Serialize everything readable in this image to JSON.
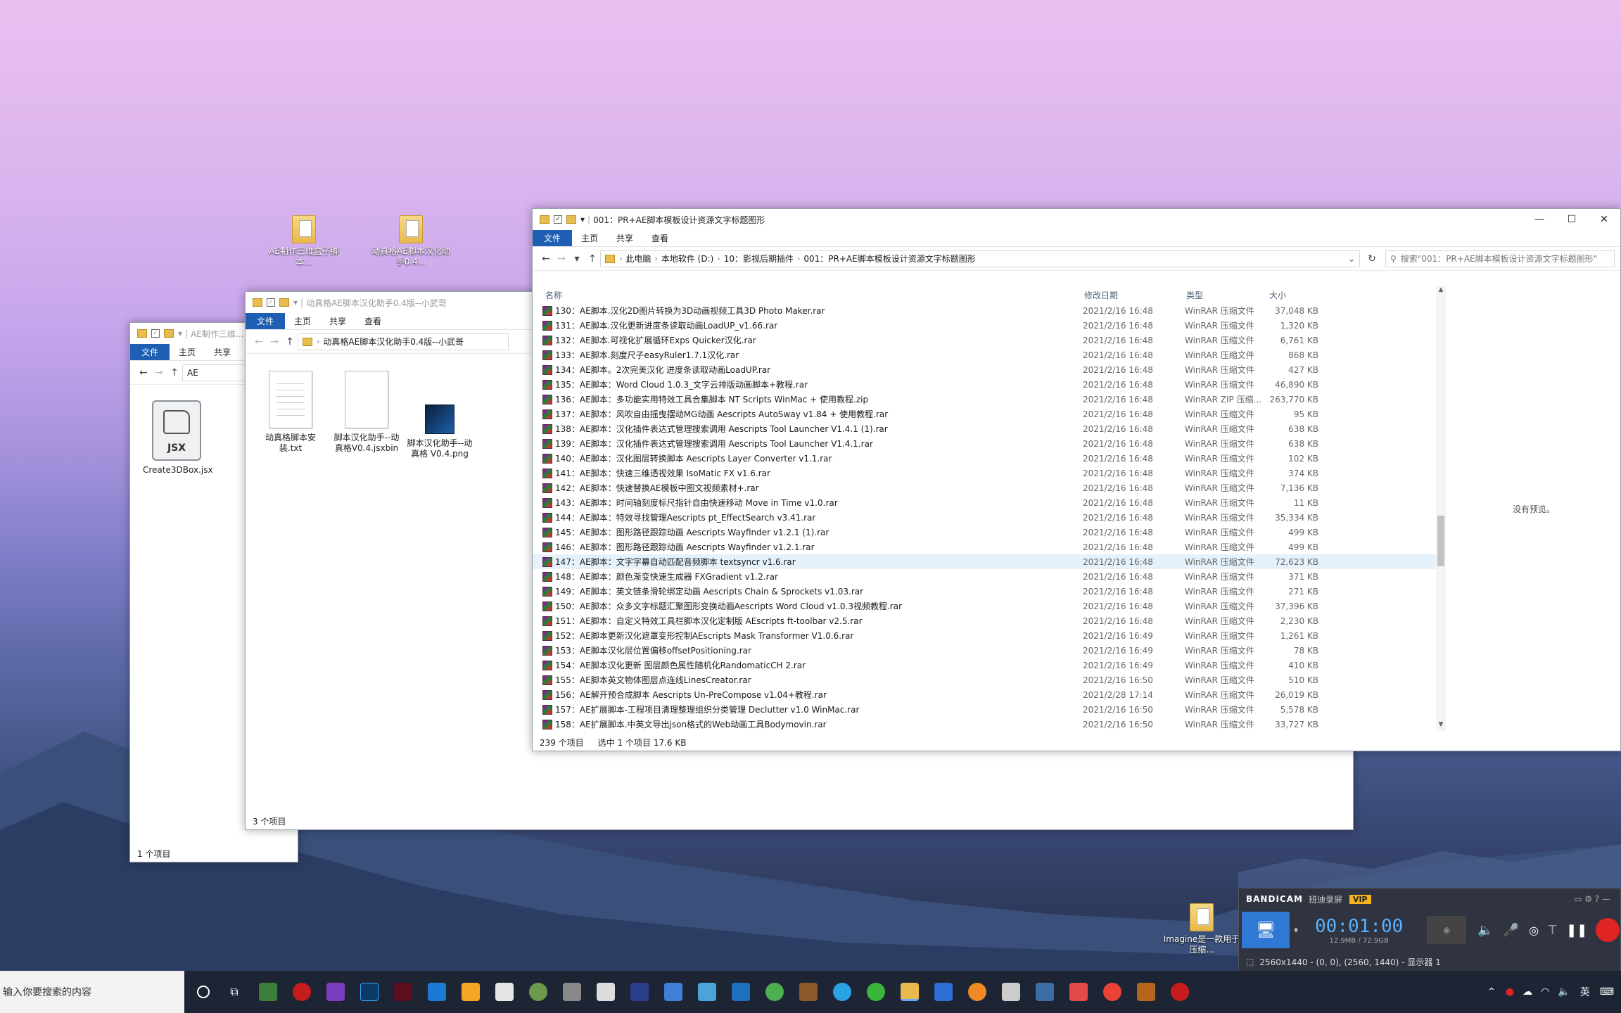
{
  "desktop": {
    "icons": [
      {
        "label": "AE制作三维盒子脚本..."
      },
      {
        "label": "动真格AE脚本汉化助手0.4..."
      },
      {
        "label": "Imagine是一款用于压缩..."
      }
    ]
  },
  "win_back": {
    "title": "AE制作三维...",
    "tabs": [
      "文件",
      "主页",
      "共享"
    ],
    "addr": "AE",
    "item_name": "Create3DBox.jsx",
    "item_icon_text": "JSX",
    "status": "1 个项目"
  },
  "win_mid": {
    "title": "动真格AE脚本汉化助手0.4版--小武哥",
    "tabs": [
      "文件",
      "主页",
      "共享",
      "查看"
    ],
    "addr": "动真格AE脚本汉化助手0.4版--小武哥",
    "items": [
      {
        "name": "动真格脚本安装.txt"
      },
      {
        "name": "脚本汉化助手--动真格V0.4.jsxbin"
      },
      {
        "name": "脚本汉化助手--动真格 V0.4.png"
      }
    ],
    "status": "3 个项目"
  },
  "win_front": {
    "title": "001：PR+AE脚本模板设计资源文字标题图形",
    "tabs": [
      "文件",
      "主页",
      "共享",
      "查看"
    ],
    "breadcrumb": [
      "此电脑",
      "本地软件 (D:)",
      "10：影视后期插件",
      "001：PR+AE脚本模板设计资源文字标题图形"
    ],
    "search_placeholder": "搜索\"001：PR+AE脚本模板设计资源文字标题图形\"",
    "columns": {
      "name": "名称",
      "date": "修改日期",
      "type": "类型",
      "size": "大小"
    },
    "files": [
      {
        "name": "130：AE脚本.汉化2D图片转换为3D动画视频工具3D Photo Maker.rar",
        "date": "2021/2/16 16:48",
        "type": "WinRAR 压缩文件",
        "size": "37,048 KB"
      },
      {
        "name": "131：AE脚本.汉化更新进度条读取动画LoadUP_v1.66.rar",
        "date": "2021/2/16 16:48",
        "type": "WinRAR 压缩文件",
        "size": "1,320 KB"
      },
      {
        "name": "132：AE脚本.可视化扩展循环Exps Quicker汉化.rar",
        "date": "2021/2/16 16:48",
        "type": "WinRAR 压缩文件",
        "size": "6,761 KB"
      },
      {
        "name": "133：AE脚本.刻度尺子easyRuler1.7.1汉化.rar",
        "date": "2021/2/16 16:48",
        "type": "WinRAR 压缩文件",
        "size": "868 KB"
      },
      {
        "name": "134：AE脚本。2次完美汉化 进度条读取动画LoadUP.rar",
        "date": "2021/2/16 16:48",
        "type": "WinRAR 压缩文件",
        "size": "427 KB"
      },
      {
        "name": "135：AE脚本：Word Cloud 1.0.3_文字云排版动画脚本+教程.rar",
        "date": "2021/2/16 16:48",
        "type": "WinRAR 压缩文件",
        "size": "46,890 KB"
      },
      {
        "name": "136：AE脚本：多功能实用特效工具合集脚本 NT Scripts WinMac + 使用教程.zip",
        "date": "2021/2/16 16:48",
        "type": "WinRAR ZIP 压缩...",
        "size": "263,770 KB"
      },
      {
        "name": "137：AE脚本：风吹自由摇曳摆动MG动画 Aescripts AutoSway v1.84 + 使用教程.rar",
        "date": "2021/2/16 16:48",
        "type": "WinRAR 压缩文件",
        "size": "95 KB"
      },
      {
        "name": "138：AE脚本：汉化插件表达式管理搜索调用 Aescripts Tool Launcher V1.4.1 (1).rar",
        "date": "2021/2/16 16:48",
        "type": "WinRAR 压缩文件",
        "size": "638 KB"
      },
      {
        "name": "139：AE脚本：汉化插件表达式管理搜索调用 Aescripts Tool Launcher V1.4.1.rar",
        "date": "2021/2/16 16:48",
        "type": "WinRAR 压缩文件",
        "size": "638 KB"
      },
      {
        "name": "140：AE脚本：汉化图层转换脚本 Aescripts Layer Converter v1.1.rar",
        "date": "2021/2/16 16:48",
        "type": "WinRAR 压缩文件",
        "size": "102 KB"
      },
      {
        "name": "141：AE脚本：快速三维透视效果 IsoMatic FX v1.6.rar",
        "date": "2021/2/16 16:48",
        "type": "WinRAR 压缩文件",
        "size": "374 KB"
      },
      {
        "name": "142：AE脚本：快速替换AE模板中图文视频素材+.rar",
        "date": "2021/2/16 16:48",
        "type": "WinRAR 压缩文件",
        "size": "7,136 KB"
      },
      {
        "name": "143：AE脚本：时间轴刻度标尺指针自由快速移动 Move in Time v1.0.rar",
        "date": "2021/2/16 16:48",
        "type": "WinRAR 压缩文件",
        "size": "11 KB"
      },
      {
        "name": "144：AE脚本：特效寻找管理Aescripts pt_EffectSearch v3.41.rar",
        "date": "2021/2/16 16:48",
        "type": "WinRAR 压缩文件",
        "size": "35,334 KB"
      },
      {
        "name": "145：AE脚本：图形路径跟踪动画 Aescripts Wayfinder v1.2.1 (1).rar",
        "date": "2021/2/16 16:48",
        "type": "WinRAR 压缩文件",
        "size": "499 KB"
      },
      {
        "name": "146：AE脚本：图形路径跟踪动画 Aescripts Wayfinder v1.2.1.rar",
        "date": "2021/2/16 16:48",
        "type": "WinRAR 压缩文件",
        "size": "499 KB"
      },
      {
        "name": "147：AE脚本：文字字幕自动匹配音频脚本 textsyncr v1.6.rar",
        "date": "2021/2/16 16:48",
        "type": "WinRAR 压缩文件",
        "size": "72,623 KB",
        "selected": true
      },
      {
        "name": "148：AE脚本：颜色渐变快速生成器 FXGradient v1.2.rar",
        "date": "2021/2/16 16:48",
        "type": "WinRAR 压缩文件",
        "size": "371 KB"
      },
      {
        "name": "149：AE脚本：英文链条滑轮绑定动画 Aescripts Chain & Sprockets v1.03.rar",
        "date": "2021/2/16 16:48",
        "type": "WinRAR 压缩文件",
        "size": "271 KB"
      },
      {
        "name": "150：AE脚本：众多文字标题汇聚图形变换动画Aescripts Word Cloud v1.0.3视频教程.rar",
        "date": "2021/2/16 16:48",
        "type": "WinRAR 压缩文件",
        "size": "37,396 KB"
      },
      {
        "name": "151：AE脚本：自定义特效工具栏脚本汉化定制版 AEscripts ft-toolbar v2.5.rar",
        "date": "2021/2/16 16:48",
        "type": "WinRAR 压缩文件",
        "size": "2,230 KB"
      },
      {
        "name": "152：AE脚本更新汉化遮罩变形控制AEscripts Mask Transformer V1.0.6.rar",
        "date": "2021/2/16 16:49",
        "type": "WinRAR 压缩文件",
        "size": "1,261 KB"
      },
      {
        "name": "153：AE脚本汉化层位置偏移offsetPositioning.rar",
        "date": "2021/2/16 16:49",
        "type": "WinRAR 压缩文件",
        "size": "78 KB"
      },
      {
        "name": "154：AE脚本汉化更新 图层颜色属性随机化RandomaticCH 2.rar",
        "date": "2021/2/16 16:49",
        "type": "WinRAR 压缩文件",
        "size": "410 KB"
      },
      {
        "name": "155：AE脚本英文物体图层点连线LinesCreator.rar",
        "date": "2021/2/16 16:50",
        "type": "WinRAR 压缩文件",
        "size": "510 KB"
      },
      {
        "name": "156：AE解开预合成脚本 Aescripts Un-PreCompose v1.04+教程.rar",
        "date": "2021/2/28 17:14",
        "type": "WinRAR 压缩文件",
        "size": "26,019 KB"
      },
      {
        "name": "157：AE扩展脚本-工程项目清理整理组织分类管理 Declutter v1.0 WinMac.rar",
        "date": "2021/2/16 16:50",
        "type": "WinRAR 压缩文件",
        "size": "5,578 KB"
      },
      {
        "name": "158：AE扩展脚本.中英文导出json格式的Web动画工具Bodymovin.rar",
        "date": "2021/2/16 16:50",
        "type": "WinRAR 压缩文件",
        "size": "33,727 KB"
      }
    ],
    "preview_text": "没有预览。",
    "status_count": "239 个项目",
    "status_selected": "选中 1 个项目  17.6 KB"
  },
  "bandicam": {
    "brand": "BANDICAM",
    "mode": "班迪录屏",
    "vip": "VIP",
    "timer": "00:01:00",
    "size": "12.9MB / 72.9GB",
    "info": "2560x1440 - (0, 0), (2560, 1440) - 显示器 1"
  },
  "taskbar": {
    "search_placeholder": "输入你要搜索的内容",
    "ime": "英"
  }
}
